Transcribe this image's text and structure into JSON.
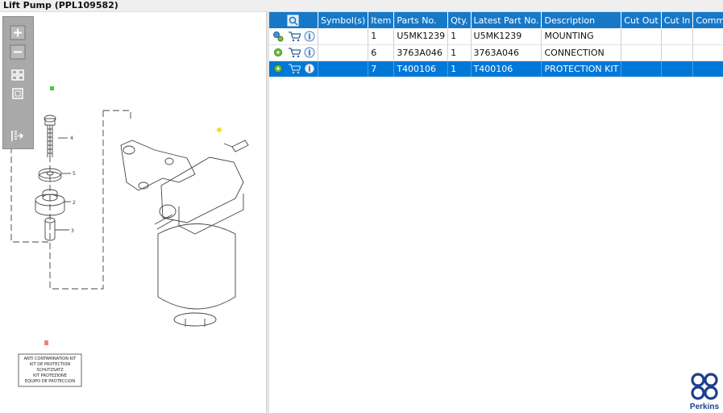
{
  "window": {
    "title": "Lift Pump (PPL109582)"
  },
  "toolbar": {
    "tools": [
      "zoom-in",
      "zoom-out",
      "fit-all",
      "fit-window",
      "move-to-list"
    ]
  },
  "drawing": {
    "callouts": [
      "4",
      "5",
      "2",
      "3"
    ],
    "kit_label_lines": [
      "ANTI CONTAMINATION KIT",
      "KIT DE PROTECTION",
      "SCHUTZSATZ",
      "KIT PROTEZIONE",
      "EQUIPO DE PROTECCION"
    ]
  },
  "table": {
    "columns": [
      "",
      "Symbol(s)",
      "Item",
      "Parts No.",
      "Qty.",
      "Latest Part No.",
      "Description",
      "Cut Out",
      "Cut In",
      "Comments"
    ],
    "rows": [
      {
        "symbols": "",
        "item": "1",
        "part_no": "U5MK1239",
        "qty": "1",
        "latest_part_no": "U5MK1239",
        "description": "MOUNTING",
        "cut_out": "",
        "cut_in": "",
        "comments": ""
      },
      {
        "symbols": "",
        "item": "6",
        "part_no": "3763A046",
        "qty": "1",
        "latest_part_no": "3763A046",
        "description": "CONNECTION",
        "cut_out": "",
        "cut_in": "",
        "comments": ""
      },
      {
        "symbols": "",
        "item": "7",
        "part_no": "T400106",
        "qty": "1",
        "latest_part_no": "T400106",
        "description": "PROTECTION KIT",
        "cut_out": "",
        "cut_in": "",
        "comments": ""
      }
    ]
  },
  "brand": {
    "name": "Perkins",
    "color": "#1b3f8f",
    "accent": "#0078d7"
  }
}
